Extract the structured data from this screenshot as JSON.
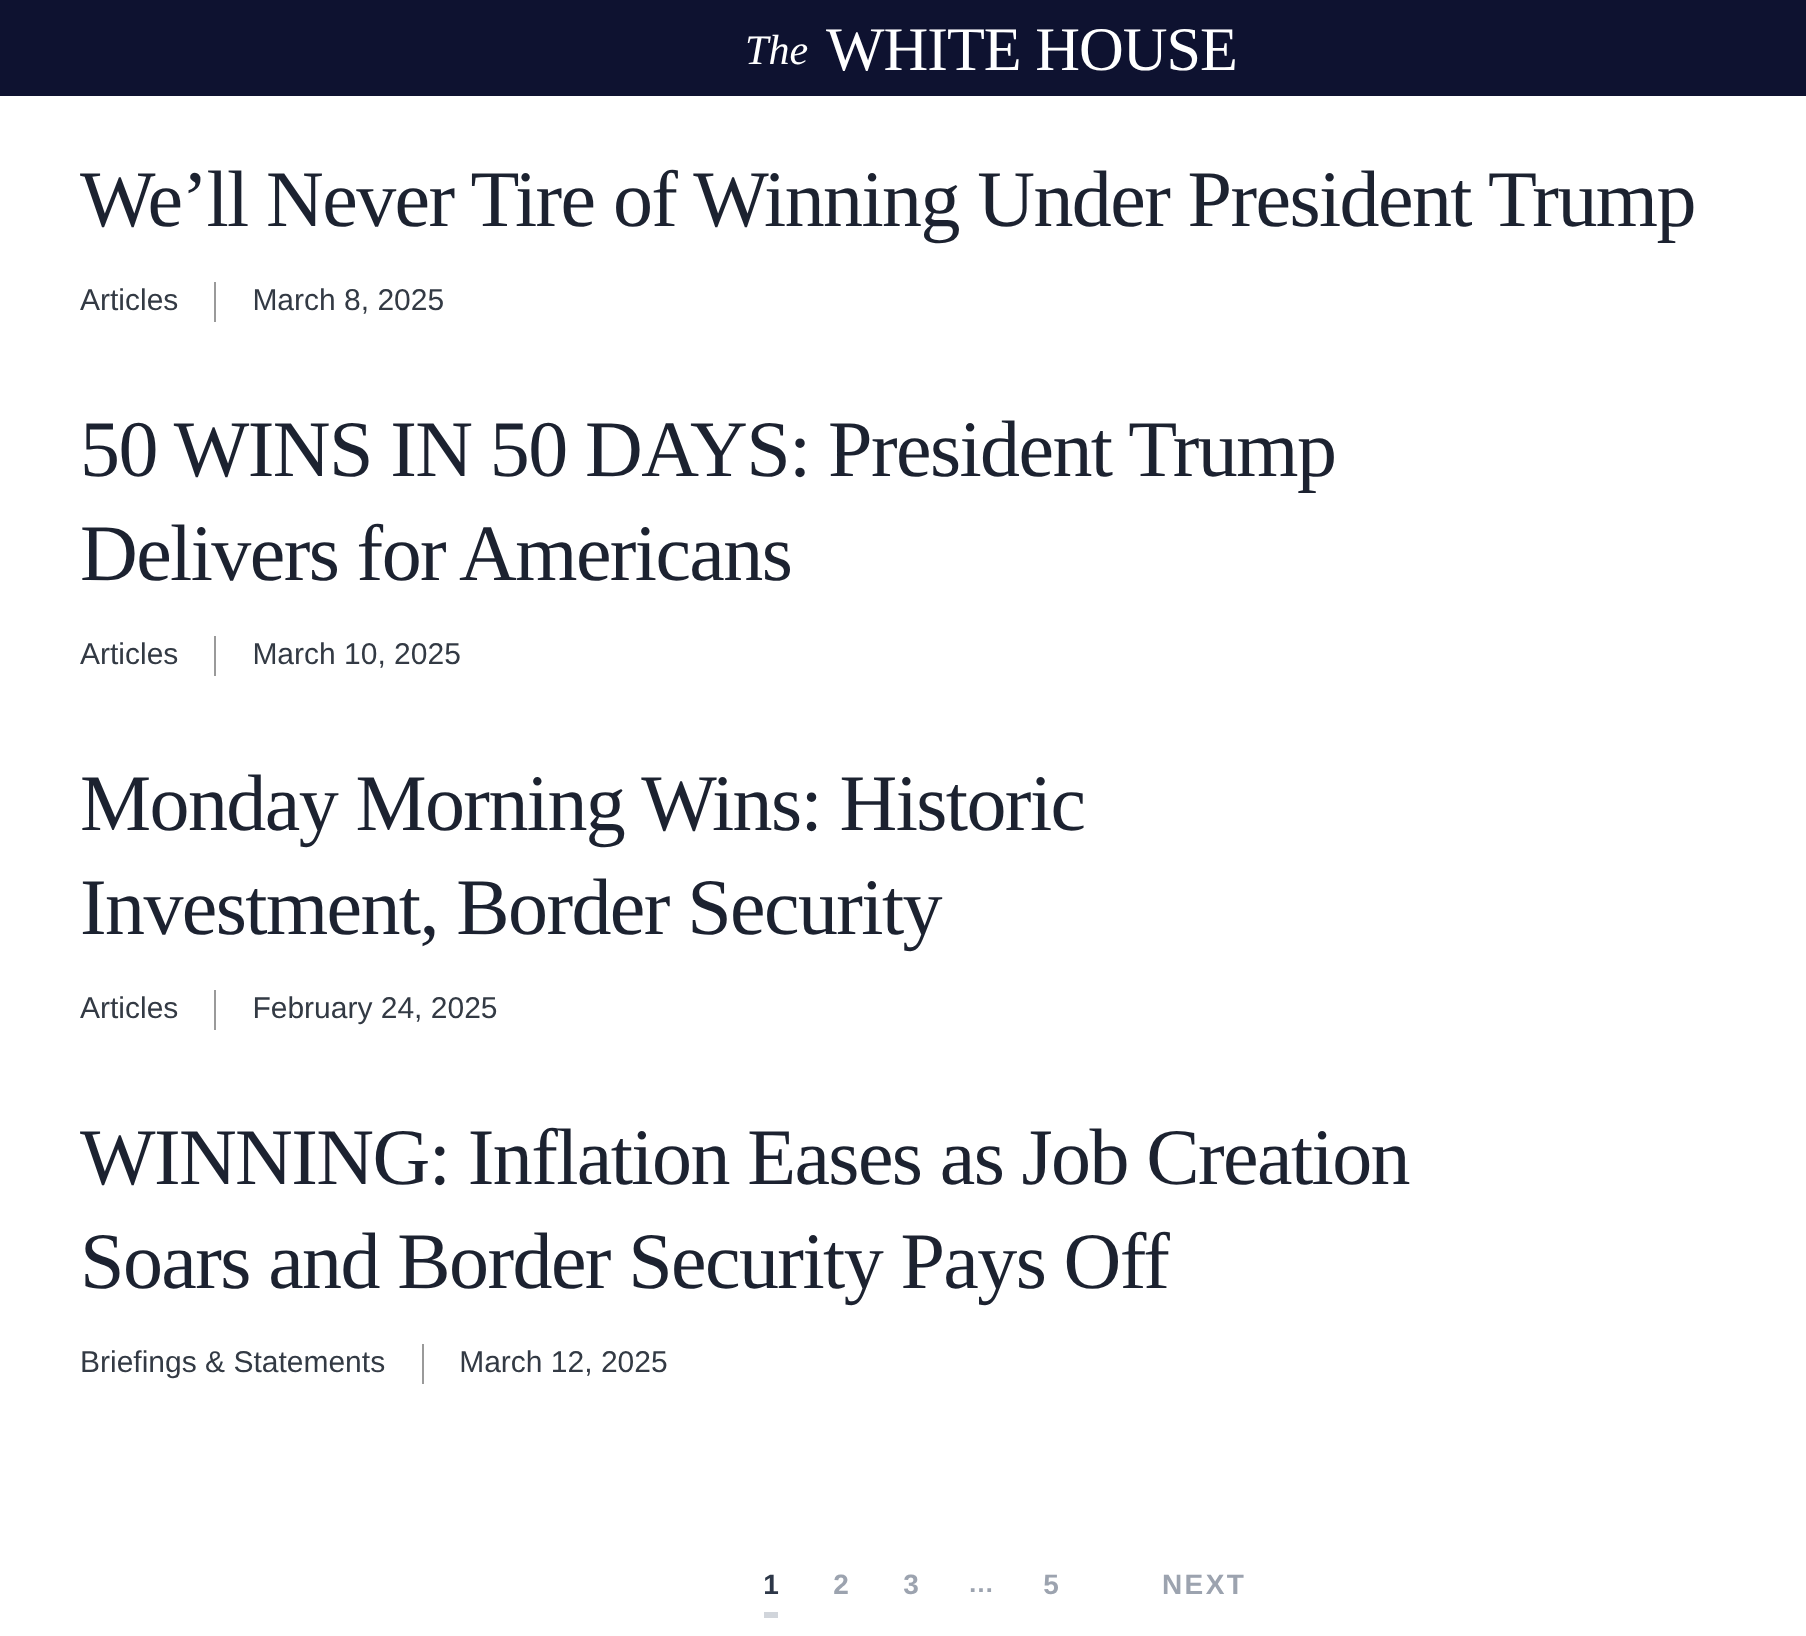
{
  "header": {
    "prefix": "The",
    "title": "WHITE HOUSE"
  },
  "articles": [
    {
      "title": "We’ll Never Tire of Winning Under President Trump",
      "category": "Articles",
      "date": "March 8, 2025"
    },
    {
      "title": "50 WINS IN 50 DAYS: President Trump Delivers for Americans",
      "category": "Articles",
      "date": "March 10, 2025"
    },
    {
      "title": "Monday Morning Wins: Historic Investment, Border Security",
      "category": "Articles",
      "date": "February 24, 2025"
    },
    {
      "title": "WINNING: Inflation Eases as Job Creation Soars and Border Security Pays Off",
      "category": "Briefings & Statements",
      "date": "March 12, 2025"
    }
  ],
  "pagination": {
    "pages": [
      {
        "kind": "page",
        "label": "1",
        "selected": true
      },
      {
        "kind": "page",
        "label": "2",
        "selected": false
      },
      {
        "kind": "page",
        "label": "3",
        "selected": false
      },
      {
        "kind": "ellipsis",
        "label": "…",
        "selected": false
      },
      {
        "kind": "page",
        "label": "5",
        "selected": false
      }
    ],
    "next": "NEXT"
  }
}
